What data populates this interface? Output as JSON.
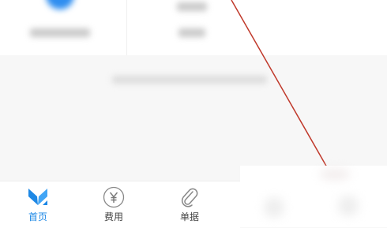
{
  "tabbar": {
    "tabs": [
      {
        "label": "首页",
        "icon": "logo-m-icon",
        "active": true
      },
      {
        "label": "费用",
        "icon": "yen-circle-icon",
        "active": false
      },
      {
        "label": "单据",
        "icon": "paperclip-icon",
        "active": false
      }
    ]
  },
  "colors": {
    "accent": "#1e88e5",
    "annotation_line": "#c0392b",
    "tab_text": "#444444",
    "icon_gray": "#888888"
  }
}
